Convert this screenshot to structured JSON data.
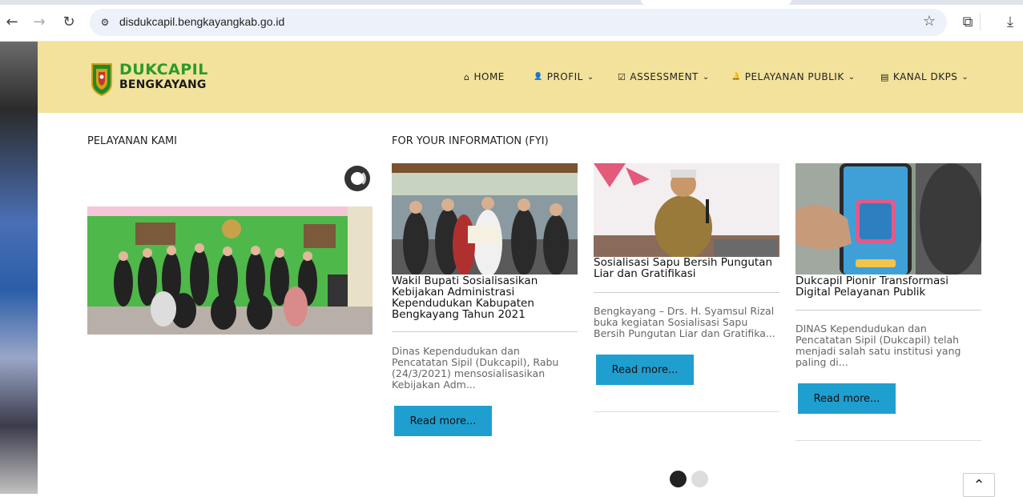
{
  "browser": {
    "url": "disdukcapil.bengkayangkab.go.id",
    "back_icon": "←",
    "forward_icon": "→",
    "reload_icon": "↻",
    "star_icon": "☆",
    "extensions_icon": "⧉",
    "download_icon": "⤓"
  },
  "site": {
    "logo_line1": "DUKCAPIL",
    "logo_line2": "BENGKAYANG",
    "brand_green": "#2a9a2a",
    "header_bg": "#f2e29b"
  },
  "menu": [
    {
      "icon": "⌂",
      "label": "HOME",
      "dropdown": ""
    },
    {
      "icon": "👤",
      "label": "PROFIL",
      "dropdown": "⌄"
    },
    {
      "icon": "☑",
      "label": "ASSESSMENT",
      "dropdown": "⌄"
    },
    {
      "icon": "🔔",
      "label": "PELAYANAN PUBLIK",
      "dropdown": "⌄"
    },
    {
      "icon": "▤",
      "label": "KANAL DKPS",
      "dropdown": "⌄"
    }
  ],
  "sections": {
    "services_title": "PELAYANAN KAMI",
    "fyi_title": "FOR YOUR INFORMATION (FYI)"
  },
  "cards": [
    {
      "title": "Wakil Bupati Sosialisasikan Kebijakan Administrasi Kependudukan Kabupaten Bengkayang Tahun 2021",
      "excerpt": "Dinas Kependudukan dan Pencatatan Sipil (Dukcapil), Rabu (24/3/2021) mensosialisasikan Kebijakan Adm...",
      "button": "Read more..."
    },
    {
      "title": "Sosialisasi Sapu Bersih Pungutan Liar dan Gratifikasi",
      "excerpt": "Bengkayang – Drs. H. Syamsul Rizal buka kegiatan Sosialisasi Sapu Bersih Pungutan Liar dan Gratifika...",
      "button": "Read more..."
    },
    {
      "title": "Dukcapil Pionir Transformasi Digital Pelayanan Publik",
      "excerpt": "DINAS Kependudukan dan Pencatatan Sipil (Dukcapil) telah menjadi salah satu institusi yang paling di...",
      "button": "Read more..."
    }
  ],
  "scroll_top_icon": "⌃",
  "button_color": "#1f9fd0"
}
